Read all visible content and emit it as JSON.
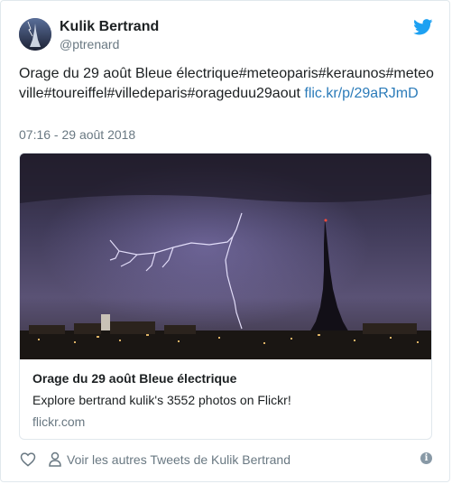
{
  "author": {
    "name": "Kulik Bertrand",
    "handle": "@ptrenard"
  },
  "tweet": {
    "text": "Orage du 29 août Bleue électrique#meteoparis#keraunos#meteoville#toureiffel#villedeparis#orageduu29aout ",
    "link_text": "flic.kr/p/29aRJmD",
    "timestamp": "07:16 - 29 août 2018"
  },
  "media": {
    "title": "Orage du 29 août Bleue électrique",
    "description": "Explore bertrand kulik's 3552 photos on Flickr!",
    "domain": "flickr.com"
  },
  "footer": {
    "more_tweets_label": "Voir les autres Tweets de Kulik Bertrand",
    "info_glyph": "i"
  },
  "icons": {
    "brand": "twitter-bird-icon",
    "like": "heart-icon",
    "user": "user-icon",
    "info": "info-icon"
  },
  "colors": {
    "brand": "#1da1f2",
    "link": "#2b7bb9",
    "muted": "#697882"
  }
}
